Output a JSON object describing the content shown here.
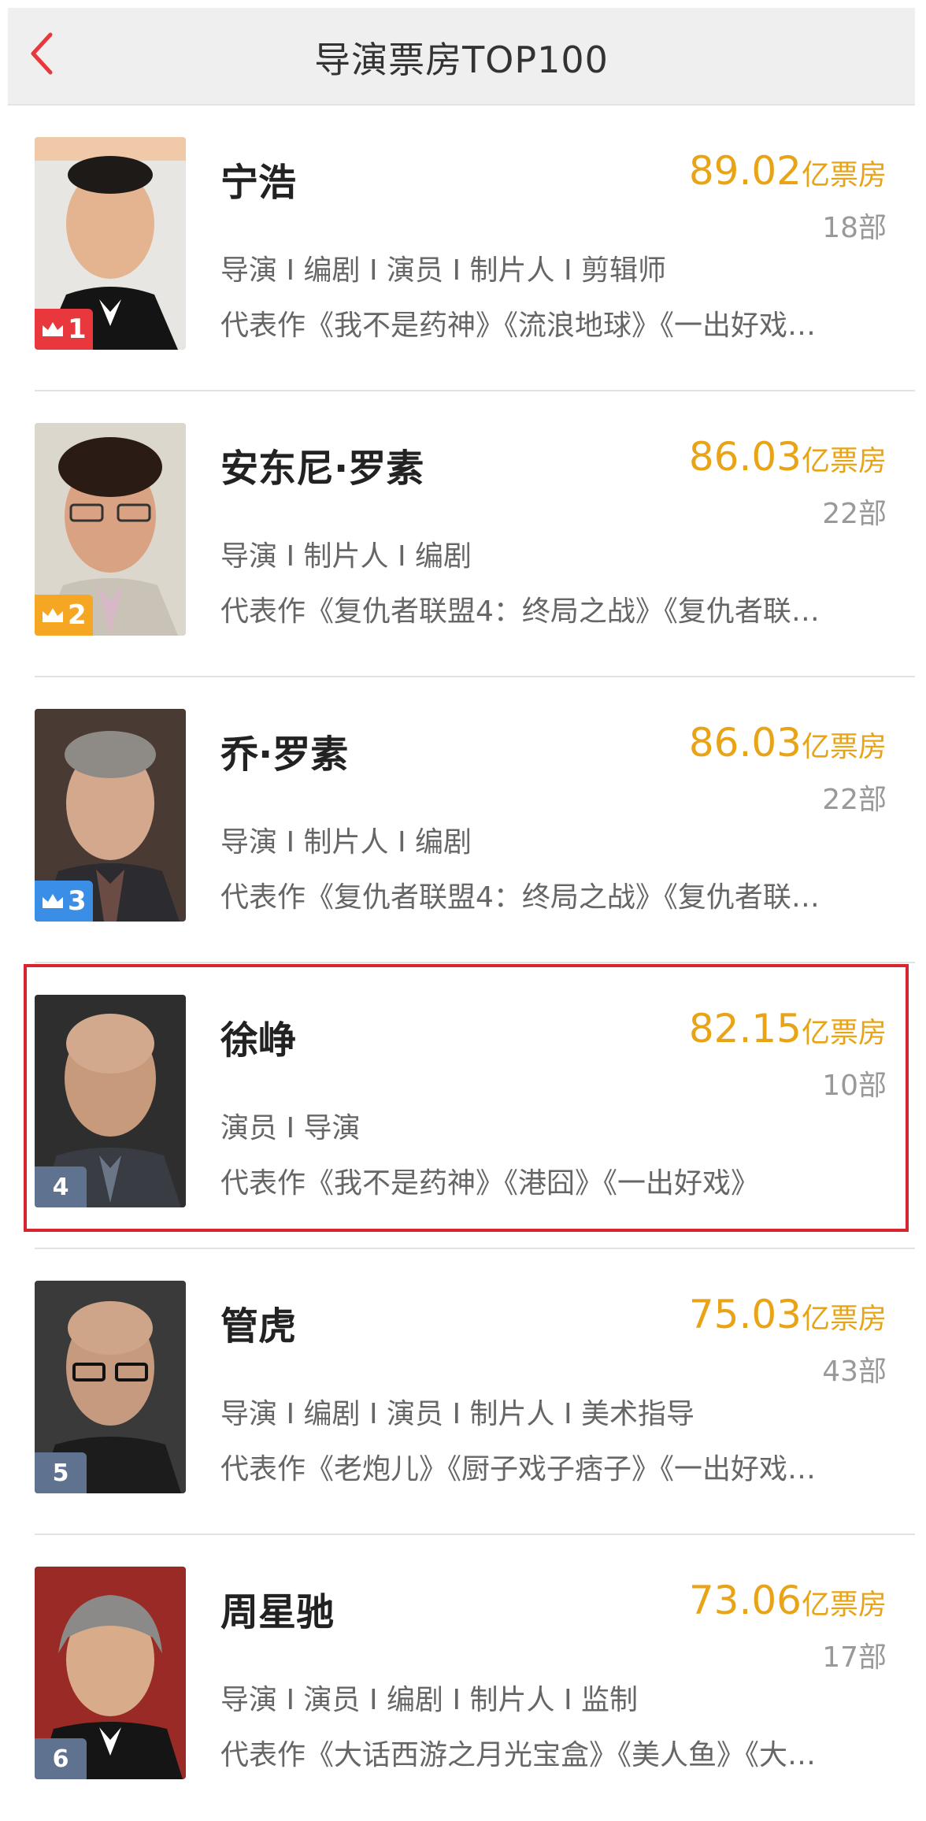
{
  "header": {
    "title": "导演票房TOP100"
  },
  "colors": {
    "accent": "#e8a317",
    "rank1": "#e8383d",
    "rank2": "#f5a623",
    "rank3": "#3a8ee6",
    "rank_other": "#5f7391",
    "highlight": "#d9232d"
  },
  "items": [
    {
      "name": "宁浩",
      "boxoffice": "89.02",
      "unit": "亿票房",
      "count": "18部",
      "roles": "导演 I 编剧 I 演员 I 制片人 I 剪辑师",
      "works": "代表作《我不是药神》《流浪地球》《一出好戏…",
      "rank": "1",
      "crown": true
    },
    {
      "name": "安东尼·罗素",
      "boxoffice": "86.03",
      "unit": "亿票房",
      "count": "22部",
      "roles": "导演 I 制片人 I 编剧",
      "works": "代表作《复仇者联盟4：终局之战》《复仇者联…",
      "rank": "2",
      "crown": true
    },
    {
      "name": "乔·罗素",
      "boxoffice": "86.03",
      "unit": "亿票房",
      "count": "22部",
      "roles": "导演 I 制片人 I 编剧",
      "works": "代表作《复仇者联盟4：终局之战》《复仇者联…",
      "rank": "3",
      "crown": true
    },
    {
      "name": "徐峥",
      "boxoffice": "82.15",
      "unit": "亿票房",
      "count": "10部",
      "roles": "演员 I 导演",
      "works": "代表作《我不是药神》《港囧》《一出好戏》",
      "rank": "4",
      "crown": false
    },
    {
      "name": "管虎",
      "boxoffice": "75.03",
      "unit": "亿票房",
      "count": "43部",
      "roles": "导演 I 编剧 I 演员 I 制片人 I 美术指导",
      "works": "代表作《老炮儿》《厨子戏子痞子》《一出好戏…",
      "rank": "5",
      "crown": false
    },
    {
      "name": "周星驰",
      "boxoffice": "73.06",
      "unit": "亿票房",
      "count": "17部",
      "roles": "导演 I 演员 I 编剧 I 制片人 I 监制",
      "works": "代表作《大话西游之月光宝盒》《美人鱼》《大…",
      "rank": "6",
      "crown": false
    }
  ]
}
